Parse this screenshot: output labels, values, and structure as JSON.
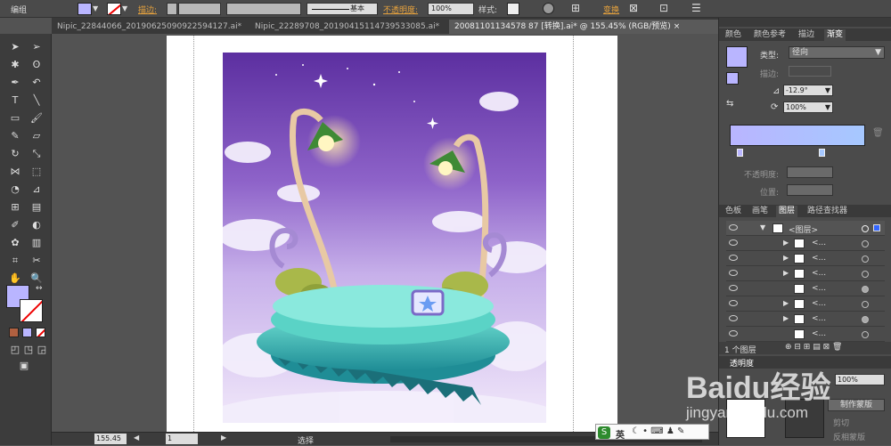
{
  "control_bar": {
    "mode_label": "编组",
    "stroke_label": "描边:",
    "stroke_style": "基本",
    "opacity_label": "不透明度:",
    "opacity_value": "100%",
    "style_label": "样式:",
    "transform_label": "变换"
  },
  "tabs": [
    {
      "label": "Nipic_22844066_20190625090922594127.ai*",
      "active": false
    },
    {
      "label": "Nipic_22289708_20190415114739533085.ai*",
      "active": false
    },
    {
      "label": "20081101134578 87 [转换].ai* @ 155.45% (RGB/预览)",
      "active": true
    }
  ],
  "status": {
    "zoom": "155.45",
    "page": "1",
    "tool": "选择"
  },
  "gradient_panel": {
    "tabs": [
      "颜色",
      "颜色参考",
      "描边",
      "渐变"
    ],
    "type_label": "类型:",
    "type_value": "径向",
    "stroke_label": "描边:",
    "angle_value": "-12.9°",
    "ratio_value": "100%",
    "opacity_label": "不透明度:",
    "location_label": "位置:",
    "colors": {
      "start": "#b9b5ff",
      "end": "#a6c8ff"
    }
  },
  "layers_panel": {
    "tabs": [
      "色板",
      "画笔",
      "图层",
      "路径查找器"
    ],
    "group_name": "<图层>",
    "items": [
      "<...",
      "<...",
      "<...",
      "<...",
      "<...",
      "<...",
      "<..."
    ],
    "count": "1 个图层"
  },
  "transparency_panel": {
    "title": "透明度",
    "opacity": "100%",
    "make_mask": "制作蒙版",
    "clip": "剪切",
    "invert": "反相蒙版"
  },
  "ime": {
    "label": "英"
  },
  "watermark": {
    "brand": "Baidu经验",
    "url": "jingyan.baidu.com"
  }
}
